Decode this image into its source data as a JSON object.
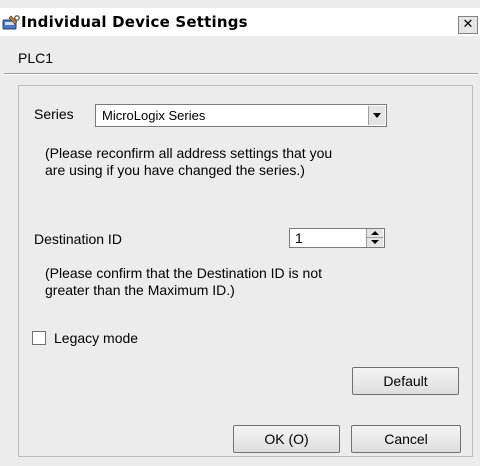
{
  "window": {
    "title": "Individual Device Settings",
    "close_label": "✕",
    "icon": "wrench-icon"
  },
  "device_name": "PLC1",
  "series": {
    "label": "Series",
    "value": "MicroLogix Series",
    "note_line1": "(Please reconfirm all address settings that you",
    "note_line2": "are using if you have changed the series.)"
  },
  "destination": {
    "label": "Destination ID",
    "value": "1",
    "note_line1": "(Please confirm that the Destination ID is not",
    "note_line2": "greater than the Maximum ID.)"
  },
  "legacy_mode": {
    "label": "Legacy mode",
    "checked": false
  },
  "buttons": {
    "default": "Default",
    "ok": "OK (O)",
    "cancel": "Cancel"
  }
}
